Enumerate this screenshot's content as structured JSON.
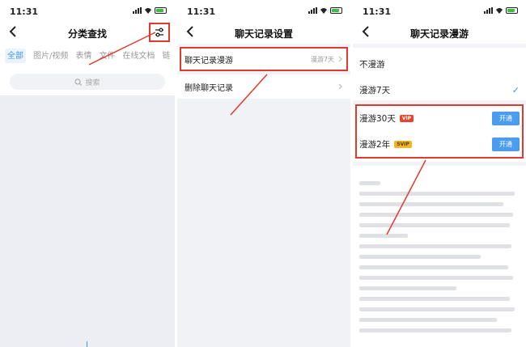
{
  "status": {
    "time": "11:31"
  },
  "panel1": {
    "title": "分类查找",
    "tabs": [
      "全部",
      "图片/视频",
      "表情",
      "文件",
      "在线文档",
      "链"
    ],
    "search_placeholder": "搜索"
  },
  "panel2": {
    "title": "聊天记录设置",
    "roam_label": "聊天记录漫游",
    "roam_value": "漫游7天",
    "delete_label": "删除聊天记录"
  },
  "panel3": {
    "title": "聊天记录漫游",
    "options": [
      {
        "label": "不漫游"
      },
      {
        "label": "漫游7天",
        "selected": true
      },
      {
        "label": "漫游30天",
        "badge": "VIP",
        "action": "开通"
      },
      {
        "label": "漫游2年",
        "badge": "SVIP",
        "action": "开通"
      }
    ]
  },
  "colors": {
    "accent": "#3f97e7",
    "highlight": "#e03a2f",
    "vip": "#e8452c",
    "svip": "#f4b521"
  }
}
